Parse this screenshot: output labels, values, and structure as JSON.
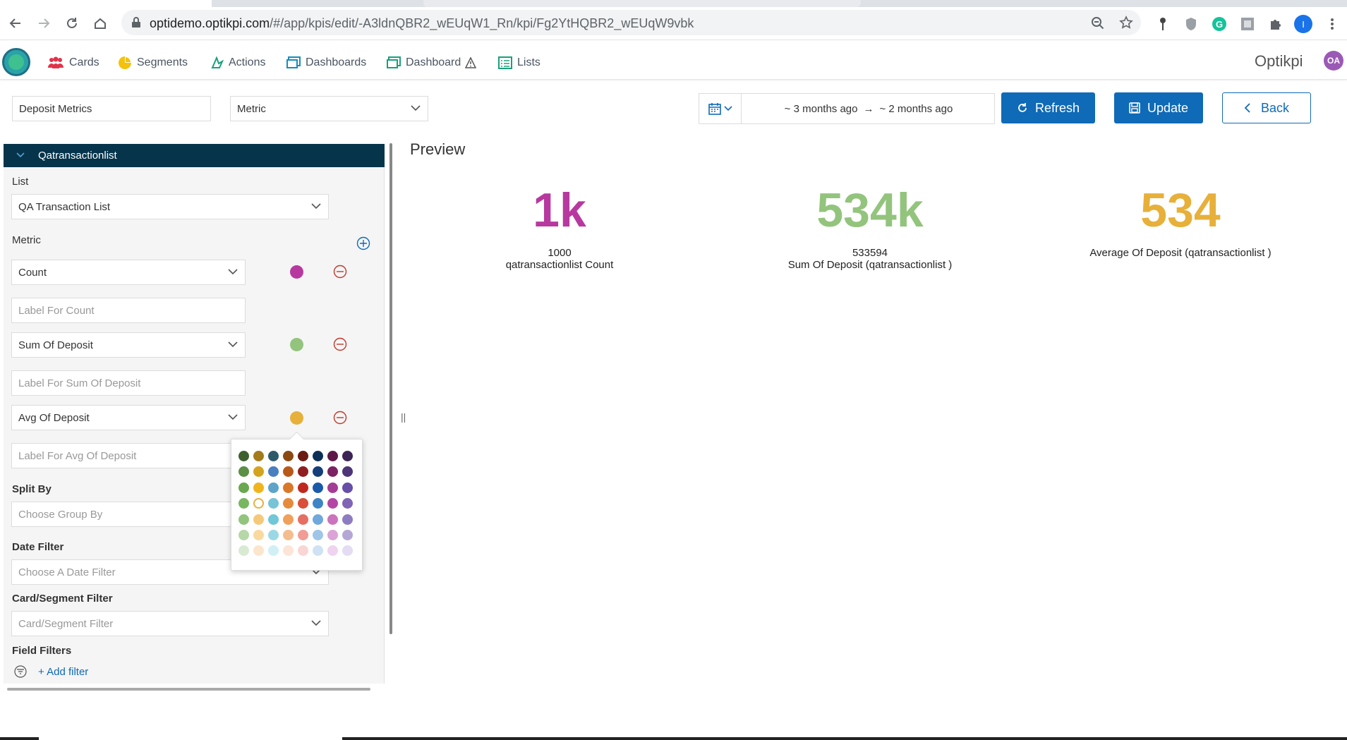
{
  "browser": {
    "url_host": "optidemo.optikpi.com",
    "url_path": "/#/app/kpis/edit/-A3ldnQBR2_wEUqW1_Rn/kpi/Fg2YtHQBR2_wEUqW9vbk",
    "profile_initial": "I"
  },
  "nav": {
    "items": [
      {
        "label": "Cards",
        "icon": "users-icon"
      },
      {
        "label": "Segments",
        "icon": "pie-chart-icon"
      },
      {
        "label": "Actions",
        "icon": "actions-icon"
      },
      {
        "label": "Dashboards",
        "icon": "dashboard-icon"
      },
      {
        "label": "Dashboard",
        "icon": "dashboard-warning-icon"
      },
      {
        "label": "Lists",
        "icon": "list-icon"
      }
    ],
    "brand": "Optikpi",
    "avatar": "OA"
  },
  "toolbar": {
    "name_value": "Deposit Metrics",
    "type_value": "Metric",
    "date_range_from": "~ 3 months ago",
    "date_range_arrow": "→",
    "date_range_to": "~ 2 months ago",
    "refresh_label": "Refresh",
    "update_label": "Update",
    "back_label": "Back"
  },
  "panel": {
    "header": "Qatransactionlist",
    "list_label": "List",
    "list_value": "QA Transaction List",
    "metric_label": "Metric",
    "metrics": [
      {
        "value": "Count",
        "label_placeholder": "Label For Count",
        "color": "#b7399f"
      },
      {
        "value": "Sum Of Deposit",
        "label_placeholder": "Label For Sum Of Deposit",
        "color": "#93c47d"
      },
      {
        "value": "Avg Of Deposit",
        "label_placeholder": "Label For Avg Of Deposit",
        "color": "#e7b03a"
      }
    ],
    "split_by_label": "Split By",
    "split_by_placeholder": "Choose Group By",
    "date_filter_label": "Date Filter",
    "date_filter_placeholder": "Choose A Date Filter",
    "card_segment_label": "Card/Segment Filter",
    "card_segment_placeholder": "Card/Segment Filter",
    "field_filters_label": "Field Filters",
    "add_filter_label": "+ Add filter"
  },
  "color_picker": {
    "rows": [
      [
        "#3d5f2e",
        "#a37b1a",
        "#2d5a6b",
        "#8c4a12",
        "#6b1a12",
        "#0d2f55",
        "#5d1848",
        "#3b2555"
      ],
      [
        "#5a8f45",
        "#d4a41e",
        "#4a7fbf",
        "#b8591a",
        "#8f1e1e",
        "#143f7a",
        "#7a2264",
        "#4d3578"
      ],
      [
        "#6aa84f",
        "#f0b41c",
        "#5ea3c8",
        "#d9782a",
        "#c0281f",
        "#1a5aa8",
        "#a43c95",
        "#674ea7"
      ],
      [
        "#79b660",
        "#ffffff",
        "#76c4d6",
        "#e68a3c",
        "#d94f3a",
        "#3d85c6",
        "#b445a5",
        "#8064b6"
      ],
      [
        "#93c47d",
        "#f6c97a",
        "#6fc7d8",
        "#f0a05a",
        "#e66f62",
        "#6fa8dc",
        "#cc73bd",
        "#8e7cc3"
      ],
      [
        "#b6d7a8",
        "#f9d9a0",
        "#9bd8e6",
        "#f4bd8d",
        "#f19c95",
        "#9fc5e8",
        "#dca3d6",
        "#b4a7d6"
      ],
      [
        "#d9ead3",
        "#fce5cd",
        "#d0f0f5",
        "#fce5d6",
        "#f9d6d3",
        "#cfe2f3",
        "#f0d3ee",
        "#e3dcf3"
      ]
    ],
    "selected": "#e7b03a"
  },
  "preview": {
    "title": "Preview",
    "kpis": [
      {
        "value": "1k",
        "line1": "1000",
        "line2": "qatransactionlist Count",
        "color": "#b7399f"
      },
      {
        "value": "534k",
        "line1": "533594",
        "line2": "Sum Of Deposit (qatransactionlist )",
        "color": "#93c47d"
      },
      {
        "value": "534",
        "line1": "Average Of Deposit (qatransactionlist )",
        "line2": "",
        "color": "#e7b03a"
      }
    ]
  }
}
